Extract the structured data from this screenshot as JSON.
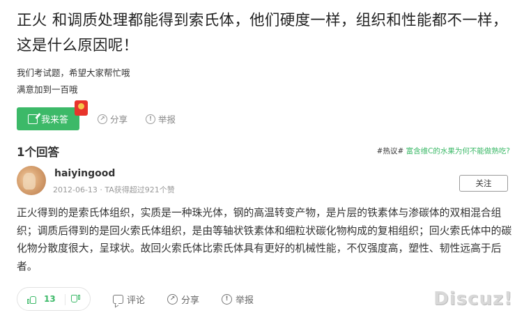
{
  "question": {
    "title": "正火 和调质处理都能得到索氏体，他们硬度一样，组织和性能都不一样，这是什么原因呢！",
    "description_lines": [
      "我们考试题，希望大家帮忙哦",
      "满意加到一百哦"
    ]
  },
  "actions": {
    "answer_label": "我来答",
    "share_label": "分享",
    "report_label": "举报"
  },
  "answers_header": {
    "count_label": "1个回答",
    "hot_tag": "#热议#",
    "hot_link": "富含维C的水果为何不能做熟吃?"
  },
  "answer": {
    "user_name": "haiyingood",
    "meta": "2012-06-13 · TA获得超过921个赞",
    "follow_label": "关注",
    "body": "正火得到的是索氏体组织，实质是一种珠光体，钢的高温转变产物，是片层的铁素体与渗碳体的双相混合组织；调质后得到的是回火索氏体组织，是由等轴状铁素体和细粒状碳化物构成的复相组织；回火索氏体中的碳化物分散度很大，呈球状。故回火索氏体比索氏体具有更好的机械性能，不仅强度高，塑性、韧性远高于后者。",
    "likes": "13",
    "comment_label": "评论",
    "share_label": "分享",
    "report_label": "举报"
  },
  "watermark": "Discuz!",
  "colors": {
    "accent": "#3cb968",
    "red_packet": "#e8342b"
  },
  "icons": [
    "edit-icon",
    "red-packet-icon",
    "share-icon",
    "report-icon",
    "thumb-up-icon",
    "thumb-down-icon",
    "comment-icon"
  ]
}
